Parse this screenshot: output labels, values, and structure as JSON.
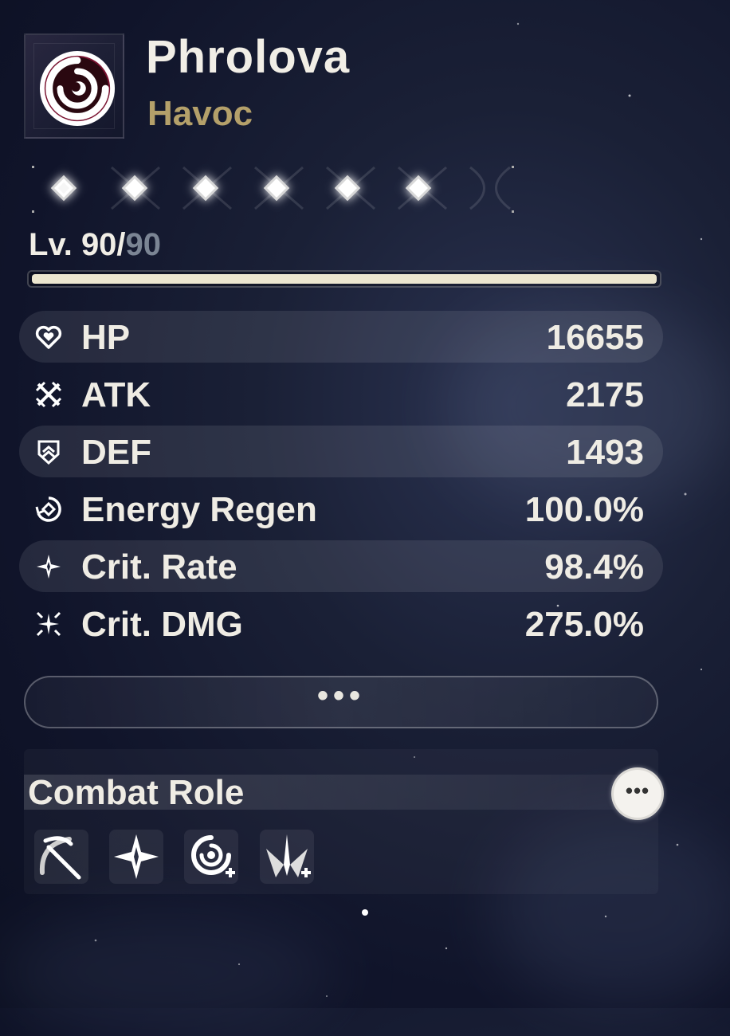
{
  "character": {
    "name": "Phrolova",
    "element": "Havoc",
    "element_icon": "havoc-swirl-icon"
  },
  "sequence": {
    "nodes_unlocked": 6,
    "nodes_total": 6
  },
  "level": {
    "current": "Lv. 90/",
    "max": "90",
    "progress": 1.0
  },
  "stats": [
    {
      "label": "HP",
      "value": "16655",
      "icon": "hp-heart-icon"
    },
    {
      "label": "ATK",
      "value": "2175",
      "icon": "atk-crossed-swords-icon"
    },
    {
      "label": "DEF",
      "value": "1493",
      "icon": "def-shield-icon"
    },
    {
      "label": "Energy Regen",
      "value": "100.0%",
      "icon": "energy-regen-icon"
    },
    {
      "label": "Crit. Rate",
      "value": "98.4%",
      "icon": "crit-rate-star-icon"
    },
    {
      "label": "Crit. DMG",
      "value": "275.0%",
      "icon": "crit-dmg-sparkle-icon"
    }
  ],
  "more_stats_label": "•••",
  "combat_role": {
    "title": "Combat Role",
    "more_label": "•••",
    "icons": [
      "scythe-icon",
      "four-point-star-icon",
      "havoc-swirl-plus-icon",
      "sword-burst-plus-icon"
    ]
  },
  "colors": {
    "accent_gold": "#b4a06a",
    "text": "#efece4",
    "level_max": "#7b8594",
    "level_fill": "#ece6cf"
  }
}
